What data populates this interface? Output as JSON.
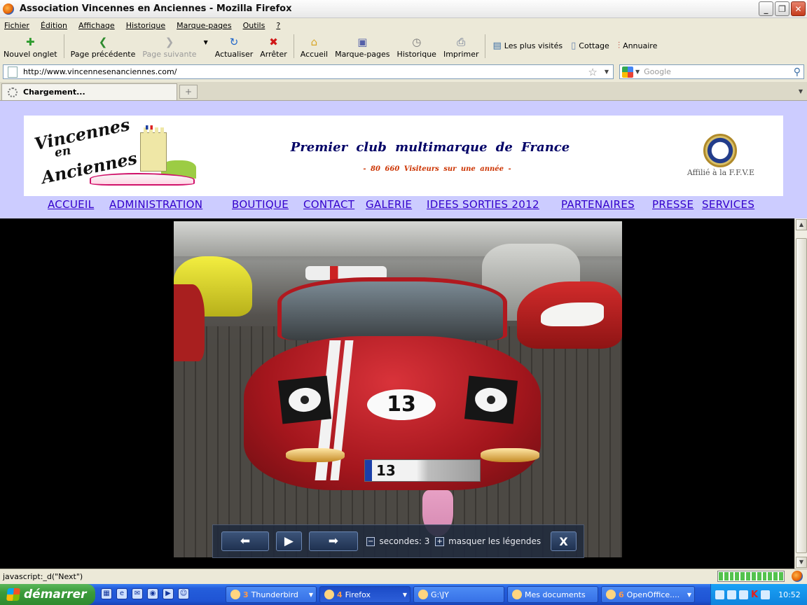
{
  "window": {
    "title": "Association Vincennes en Anciennes - Mozilla Firefox"
  },
  "menu": [
    "Fichier",
    "Édition",
    "Affichage",
    "Historique",
    "Marque-pages",
    "Outils",
    "?"
  ],
  "toolbar": {
    "new_tab": "Nouvel onglet",
    "back": "Page précédente",
    "forward": "Page suivante",
    "reload": "Actualiser",
    "stop": "Arrêter",
    "home": "Accueil",
    "bookmarks": "Marque-pages",
    "history": "Historique",
    "print": "Imprimer"
  },
  "bookmarks_bar": [
    "Les plus visités",
    "Cottage",
    "Annuaire"
  ],
  "address": {
    "url": "http://www.vincennesenanciennes.com/"
  },
  "search": {
    "placeholder": "Google"
  },
  "tabs": [
    {
      "label": "Chargement..."
    }
  ],
  "site": {
    "logo_line1": "Vincennes",
    "logo_line2": "en",
    "logo_line3": "Anciennes",
    "tagline": "Premier club multimarque de France",
    "visitors": "- 80 660 Visiteurs sur une année -",
    "affiliation": "Affilié à la F.F.V.E",
    "nav": [
      "ACCUEIL",
      "ADMINISTRATION",
      "BOUTIQUE",
      "CONTACT",
      "GALERIE",
      "IDEES SORTIES 2012",
      "PARTENAIRES",
      "PRESSE",
      "SERVICES"
    ]
  },
  "photo": {
    "race_number": "13",
    "plate": "13"
  },
  "slideshow": {
    "seconds_label": "secondes: 3",
    "captions_label": "masquer les légendes",
    "close_label": "X"
  },
  "status": {
    "text": "javascript:_d(\"Next\")",
    "progress": 1.0
  },
  "taskbar": {
    "start": "démarrer",
    "tasks": [
      {
        "count": "3",
        "label": "Thunderbird"
      },
      {
        "count": "4",
        "label": "Firefox"
      },
      {
        "count": "",
        "label": "G:\\JY"
      },
      {
        "count": "",
        "label": "Mes documents"
      },
      {
        "count": "6",
        "label": "OpenOffice...."
      }
    ],
    "clock": "10:52"
  }
}
